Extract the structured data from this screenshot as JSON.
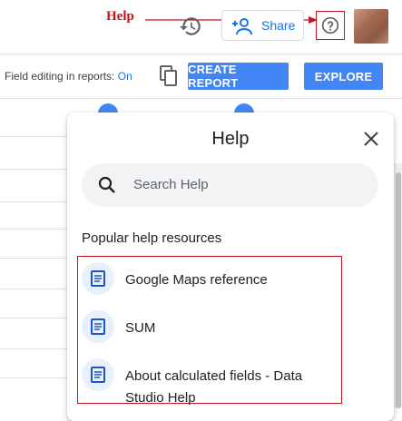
{
  "annotation": {
    "help_label": "Help",
    "color": "#c0161b"
  },
  "header": {
    "share_label": "Share",
    "history_icon": "history-icon",
    "help_icon": "help-circle-icon",
    "avatar": "user-avatar"
  },
  "toolbar": {
    "field_editing_label": "Field editing in reports:",
    "field_editing_value": "On",
    "copy_icon": "copy-icon",
    "create_report_label": "CREATE REPORT",
    "explore_label": "EXPLORE",
    "accent": "#4285f4"
  },
  "help_panel": {
    "title": "Help",
    "close_icon": "close-icon",
    "search_placeholder": "Search Help",
    "section_heading": "Popular help resources",
    "resources": [
      {
        "label": "Google Maps reference",
        "icon": "document-icon"
      },
      {
        "label": "SUM",
        "icon": "document-icon"
      },
      {
        "label": "About calculated fields - Data Studio Help",
        "icon": "document-icon"
      }
    ]
  }
}
